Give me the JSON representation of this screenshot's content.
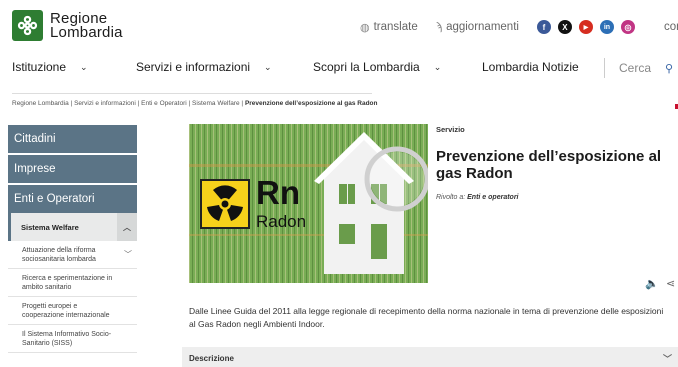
{
  "header": {
    "logo_line1": "Regione",
    "logo_line2": "Lombardia",
    "translate_label": "translate",
    "aggiornamenti_label": "aggiornamenti",
    "contatti_label": "contatti",
    "social": [
      {
        "name": "facebook",
        "glyph": "f",
        "color": "#3b5998"
      },
      {
        "name": "x",
        "glyph": "X",
        "color": "#111111"
      },
      {
        "name": "youtube",
        "glyph": "▶",
        "color": "#d62d20"
      },
      {
        "name": "linkedin",
        "glyph": "in",
        "color": "#2d6fb6"
      },
      {
        "name": "instagram",
        "glyph": "◎",
        "color": "#c13584"
      }
    ]
  },
  "nav": {
    "items": [
      {
        "label": "Istituzione"
      },
      {
        "label": "Servizi e informazioni"
      },
      {
        "label": "Scopri la Lombardia"
      },
      {
        "label": "Lombardia Notizie"
      }
    ],
    "search_placeholder": "Cerca"
  },
  "breadcrumb": {
    "items": [
      "Regione Lombardia",
      "Servizi e informazioni",
      "Enti e Operatori",
      "Sistema Welfare"
    ],
    "current": "Prevenzione dell’esposizione al gas Radon",
    "separator": "|"
  },
  "sidebar": {
    "main_items": [
      "Cittadini",
      "Imprese",
      "Enti e Operatori"
    ],
    "active_sub": "Sistema Welfare",
    "sub_items": [
      {
        "label": "Attuazione della riforma sociosanitaria lombarda",
        "has_children": true
      },
      {
        "label": "Ricerca e sperimentazione in ambito sanitario",
        "has_children": false
      },
      {
        "label": "Progetti europei e cooperazione internazionale",
        "has_children": false
      },
      {
        "label": "Il Sistema Informativo Socio-Sanitario (SISS)",
        "has_children": false
      }
    ]
  },
  "content": {
    "category": "Servizio",
    "title": "Prevenzione dell’esposizione al gas Radon",
    "audience_prefix": "Rivolto a:",
    "audience": "Enti e operatori",
    "hero_symbol": "Rn",
    "hero_word": "Radon",
    "intro": "Dalle Linee Guida del 2011 alla legge regionale di recepimento della norma nazionale in tema di prevenzione delle esposizioni al Gas Radon negli Ambienti Indoor.",
    "accordion_label": "Descrizione"
  },
  "colors": {
    "brand_green": "#2e7d32",
    "sidebar_blue": "#5b7486",
    "link_blue": "#3a66a6"
  }
}
